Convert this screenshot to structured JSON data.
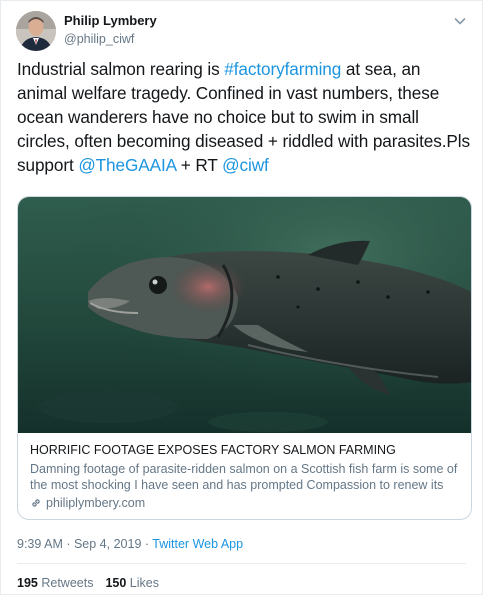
{
  "author": {
    "name": "Philip Lymbery",
    "handle": "@philip_ciwf"
  },
  "tweet": {
    "text_1": "Industrial salmon rearing is ",
    "hashtag": "#factoryfarming",
    "text_2": " at sea, an animal welfare tragedy. Confined in vast numbers, these ocean wanderers have no choice but to swim in small circles, often becoming diseased + riddled with parasites.Pls support ",
    "mention_1": "@TheGAAIA",
    "text_3": " + RT ",
    "mention_2": "@ciwf"
  },
  "card": {
    "title": "HORRIFIC FOOTAGE EXPOSES FACTORY SALMON FARMING",
    "description": "Damning footage of parasite-ridden salmon on a Scottish fish farm is some of the most shocking I have seen and has prompted Compassion to renew its call for ...",
    "domain": "philiplymbery.com"
  },
  "meta": {
    "time_date": "9:39 AM · Sep 4, 2019 · ",
    "source": "Twitter Web App"
  },
  "stats": {
    "retweets_count": "195",
    "retweets_label": "Retweets",
    "likes_count": "150",
    "likes_label": "Likes"
  },
  "colors": {
    "link": "#1b95e0",
    "secondary_text": "#657786",
    "border": "#e6ecf0"
  }
}
